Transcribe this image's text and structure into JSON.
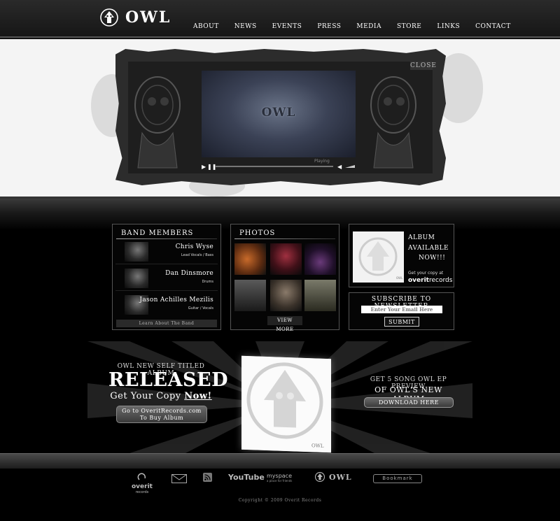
{
  "header": {
    "logo_text": "OWL",
    "nav": [
      "About",
      "News",
      "Events",
      "Press",
      "Media",
      "Store",
      "Links",
      "Contact"
    ]
  },
  "video": {
    "close_label": "Close",
    "screen_logo": "OWL",
    "status": "Playing",
    "progress": 0.0
  },
  "band": {
    "title": "Band Members",
    "members": [
      {
        "name": "Chris Wyse",
        "role": "Lead Vocals / Bass"
      },
      {
        "name": "Dan Dinsmore",
        "role": "Drums"
      },
      {
        "name": "Jason Achilles Mezilis",
        "role": "Guitar / Vocals"
      }
    ],
    "learn_label": "Learn About The Band"
  },
  "photos": {
    "title": "Photos",
    "view_more_label": "View More"
  },
  "album": {
    "line1": "Album",
    "line2": "Available",
    "line3": "Now!!!",
    "copy_text": "Get your copy at",
    "brand_bold": "overit",
    "brand_rest": "records"
  },
  "newsletter": {
    "title": "Subscribe To Newsletter",
    "placeholder": "Enter Your Email Here",
    "submit_label": "Submit"
  },
  "release": {
    "line1": "Owl new self titled Album",
    "big": "Released",
    "line3_prefix": "Get Your Copy ",
    "line3_now": "Now!",
    "goto_line1": "Go to OveritRecords.com",
    "goto_line2": "To Buy Album",
    "ep_line1": "Get 5 Song Owl EP Preview",
    "ep_line2": "Of Owl's New Album",
    "download_label": "Download Here",
    "cover_label": "OWL"
  },
  "footer": {
    "overit_label": "overit",
    "overit_sub": "records",
    "youtube_label": "YouTube",
    "myspace_label": "myspace",
    "myspace_sub": "a place for friends",
    "owl_label": "OWL",
    "bookmark_label": "Bookmark",
    "copyright": "Copyright © 2009 Overit Records"
  },
  "colors": {
    "background": "#000000",
    "video_band": "#f4f4f4",
    "panel_border": "#555555",
    "accent_text": "#ffffff"
  },
  "icons": [
    "owl-emblem-icon",
    "play-icon",
    "pause-icon",
    "volume-icon",
    "mail-icon",
    "rss-icon",
    "youtube-icon",
    "myspace-icon"
  ]
}
